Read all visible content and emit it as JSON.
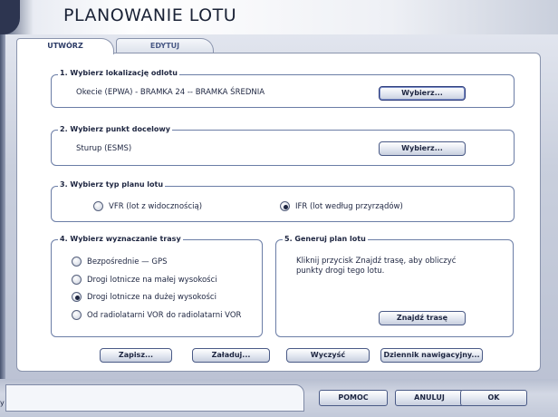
{
  "window": {
    "title": "PLANOWANIE LOTU"
  },
  "tabs": [
    {
      "label": "UTWÓRZ",
      "active": true
    },
    {
      "label": "EDYTUJ",
      "active": false
    }
  ],
  "departure": {
    "legend": "1. Wybierz lokalizację odlotu",
    "value": "Okecie (EPWA) - BRAMKA 24 -- BRAMKA ŚREDNIA",
    "button": "Wybierz..."
  },
  "destination": {
    "legend": "2. Wybierz punkt docelowy",
    "value": "Sturup (ESMS)",
    "button": "Wybierz..."
  },
  "plan_type": {
    "legend": "3. Wybierz typ planu lotu",
    "options": [
      {
        "label": "VFR (lot z widocznością)",
        "selected": false
      },
      {
        "label": "IFR (lot według przyrządów)",
        "selected": true
      }
    ]
  },
  "routing": {
    "legend": "4. Wybierz wyznaczanie trasy",
    "options": [
      {
        "label": "Bezpośrednie — GPS",
        "selected": false
      },
      {
        "label": "Drogi lotnicze na małej wysokości",
        "selected": false
      },
      {
        "label": "Drogi lotnicze na dużej wysokości",
        "selected": true
      },
      {
        "label": "Od radiolatarni VOR do radiolatarni VOR",
        "selected": false
      }
    ]
  },
  "generate": {
    "legend": "5. Generuj plan lotu",
    "text_line1": "Kliknij przycisk Znajdź trasę, aby obliczyć",
    "text_line2": "punkty drogi tego lotu.",
    "button": "Znajdź trasę"
  },
  "actions": {
    "save": "Zapisz...",
    "load": "Załaduj...",
    "clear": "Wyczyść",
    "navlog": "Dziennik nawigacyjny..."
  },
  "footer": {
    "status": "y",
    "help": "POMOC",
    "cancel": "ANULUJ",
    "ok": "OK"
  },
  "colors": {
    "accent": "#4a5a86",
    "frame": "#2d3550"
  }
}
